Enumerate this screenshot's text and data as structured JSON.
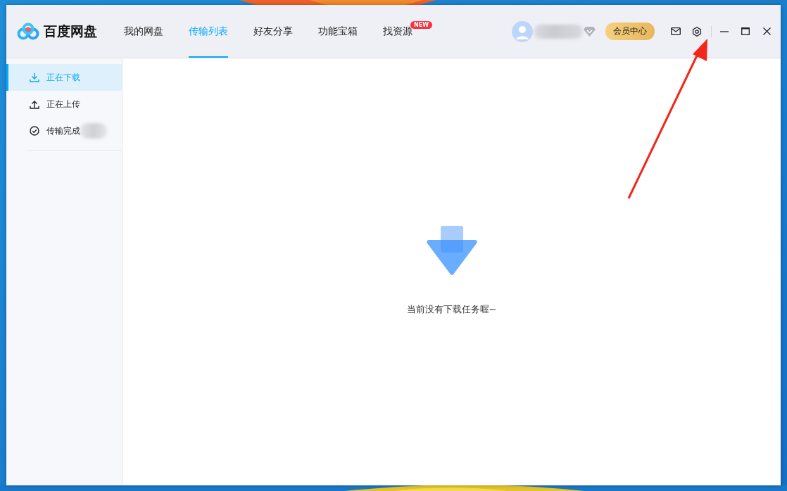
{
  "app": {
    "name": "百度网盘"
  },
  "tabs": [
    {
      "label": "我的网盘",
      "selected": false
    },
    {
      "label": "传输列表",
      "selected": true
    },
    {
      "label": "好友分享",
      "selected": false
    },
    {
      "label": "功能宝箱",
      "selected": false
    },
    {
      "label": "找资源",
      "selected": false,
      "badge": "NEW"
    }
  ],
  "account": {
    "vip_button": "会员中心"
  },
  "sidebar": {
    "items": [
      {
        "label": "正在下载",
        "kind": "download",
        "selected": true,
        "redacted": false
      },
      {
        "label": "正在上传",
        "kind": "upload",
        "selected": false,
        "redacted": false
      },
      {
        "label": "传输完成",
        "kind": "done",
        "selected": false,
        "redacted": true
      }
    ]
  },
  "empty_state": {
    "message": "当前没有下载任务喔~"
  },
  "annotation": {
    "kind": "arrow"
  }
}
